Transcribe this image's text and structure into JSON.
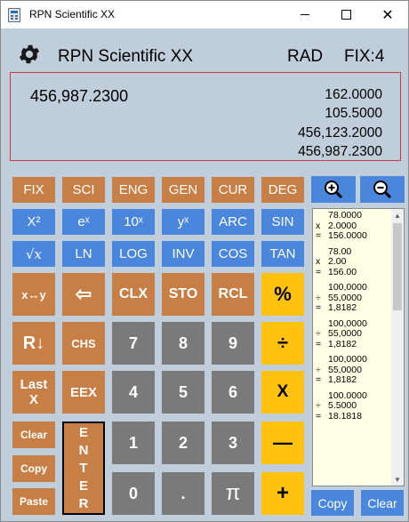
{
  "window": {
    "title": "RPN Scientific XX",
    "minimize": "",
    "maximize": "",
    "close": "✕"
  },
  "header": {
    "app_name": "RPN Scientific XX",
    "angle_mode": "RAD",
    "format": "FIX:4"
  },
  "display": {
    "x": "456,987.2300",
    "stack": [
      "162.0000",
      "105.5000",
      "456,123.2000",
      "456,987.2300"
    ]
  },
  "buttons": {
    "row1": [
      "FIX",
      "SCI",
      "ENG",
      "GEN",
      "CUR",
      "DEG"
    ],
    "row2": [
      "X²",
      "eˣ",
      "10ˣ",
      "yˣ",
      "ARC",
      "SIN"
    ],
    "row3": [
      "√x",
      "LN",
      "LOG",
      "INV",
      "COS",
      "TAN"
    ],
    "swap": "x↔y",
    "backspace": "⇦",
    "clx": "CLX",
    "sto": "STO",
    "rcl": "RCL",
    "percent": "%",
    "roll": "R↓",
    "chs": "CHS",
    "seven": "7",
    "eight": "8",
    "nine": "9",
    "divide": "÷",
    "lastx_1": "Last",
    "lastx_2": "X",
    "eex": "EEX",
    "four": "4",
    "five": "5",
    "six": "6",
    "multiply": "X",
    "clear": "Clear",
    "copy": "Copy",
    "paste": "Paste",
    "enter": [
      "E",
      "N",
      "T",
      "E",
      "R"
    ],
    "one": "1",
    "two": "2",
    "three": "3",
    "minus": "—",
    "zero": "0",
    "dot": ".",
    "pi": "π",
    "plus": "+"
  },
  "tape": {
    "entries": [
      {
        "lines": [
          [
            "",
            "78.0000"
          ],
          [
            "x",
            "2.0000"
          ],
          [
            "=",
            "156.0000"
          ]
        ]
      },
      {
        "lines": [
          [
            "",
            "78.00"
          ],
          [
            "x",
            "2.00"
          ],
          [
            "=",
            "156.00"
          ]
        ]
      },
      {
        "lines": [
          [
            "",
            "100,0000"
          ],
          [
            "÷",
            "55,0000"
          ],
          [
            "=",
            "1,8182"
          ]
        ]
      },
      {
        "lines": [
          [
            "",
            "100,0000"
          ],
          [
            "÷",
            "55,0000"
          ],
          [
            "=",
            "1,8182"
          ]
        ]
      },
      {
        "lines": [
          [
            "",
            "100,0000"
          ],
          [
            "÷",
            "55,0000"
          ],
          [
            "=",
            "1,8182"
          ]
        ]
      },
      {
        "lines": [
          [
            "",
            "100.0000"
          ],
          [
            "÷",
            "5.5000"
          ],
          [
            "=",
            "18.1818"
          ]
        ]
      }
    ],
    "copy": "Copy",
    "clear": "Clear"
  },
  "colors": {
    "background": "#c0cedc",
    "function_orange": "#c87f45",
    "function_blue": "#4a86dc",
    "digit_gray": "#7a7a7a",
    "operator_yellow": "#ffc20e",
    "display_border": "#d03a3a",
    "tape_background": "#ffffe6"
  }
}
